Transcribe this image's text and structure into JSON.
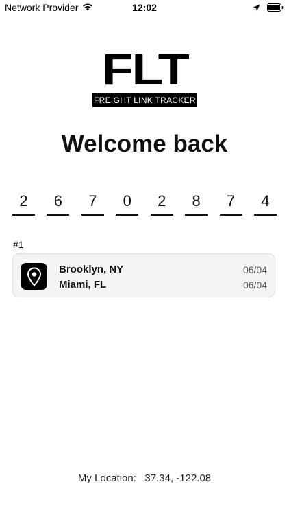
{
  "status_bar": {
    "carrier": "Network Provider",
    "time": "12:02"
  },
  "logo": {
    "mark": "FLT",
    "subtitle": "FREIGHT LINK TRACKER"
  },
  "title": "Welcome back",
  "code_digits": [
    "2",
    "6",
    "7",
    "0",
    "2",
    "8",
    "7",
    "4"
  ],
  "section_label": "#1",
  "route": {
    "origin": "Brooklyn, NY",
    "destination": "Miami, FL",
    "origin_date": "06/04",
    "destination_date": "06/04",
    "icon": "map-pin-icon"
  },
  "location": {
    "label": "My Location:",
    "value": "37.34, -122.08"
  },
  "colors": {
    "card_bg": "#f4f4f4",
    "card_border": "#dcdcdc",
    "icon_bg": "#000000"
  }
}
